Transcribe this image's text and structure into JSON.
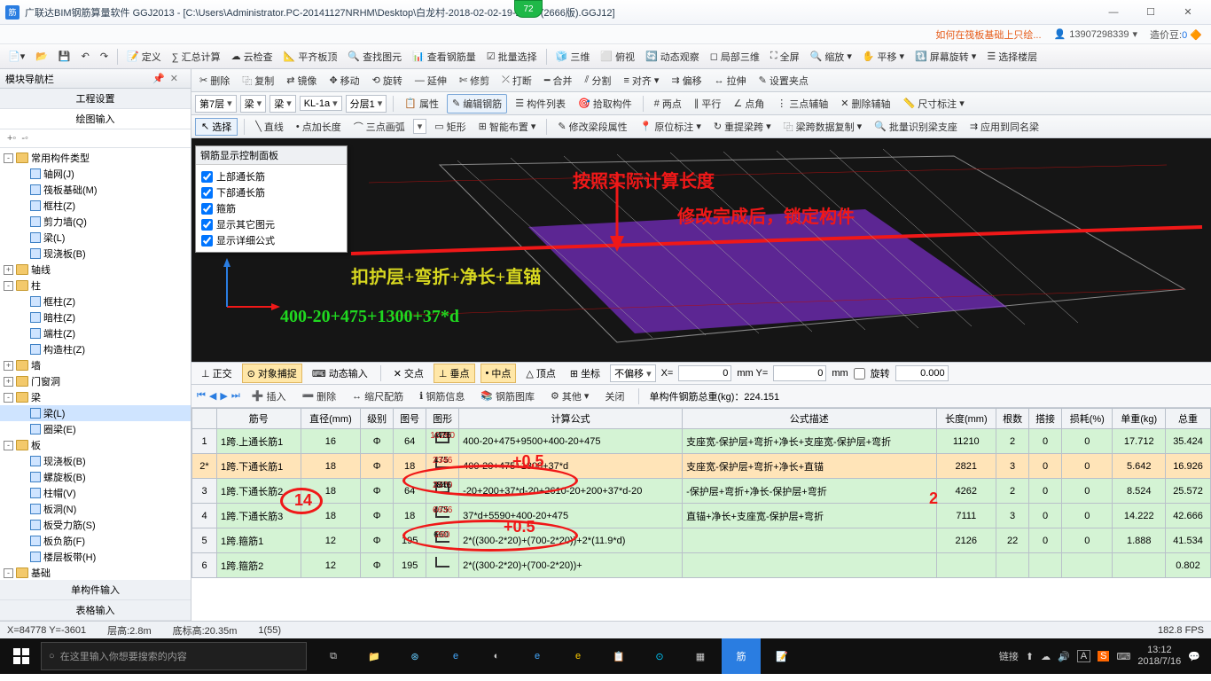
{
  "title": "广联达BIM钢筋算量软件 GGJ2013 - [C:\\Users\\Administrator.PC-20141127NRHM\\Desktop\\白龙村-2018-02-02-19-24-35(2666版).GGJ12]",
  "badge": "72",
  "linkbar": {
    "hot": "如何在筏板基础上只绘...",
    "user": "13907298339",
    "bean_lbl": "造价豆:",
    "bean_val": "0"
  },
  "toolbar1": [
    "定义",
    "∑ 汇总计算",
    "云检查",
    "平齐板顶",
    "查找图元",
    "查看钢筋量",
    "批量选择",
    "",
    "三维",
    "俯视",
    "动态观察",
    "局部三维",
    "全屏",
    "缩放",
    "平移",
    "屏幕旋转",
    "选择楼层"
  ],
  "toolbar2": [
    "删除",
    "复制",
    "镜像",
    "移动",
    "旋转",
    "延伸",
    "修剪",
    "打断",
    "合并",
    "分割",
    "对齐",
    "偏移",
    "拉伸",
    "设置夹点"
  ],
  "toolbar3_left": {
    "floor": "第7层",
    "cat": "梁",
    "type": "梁",
    "name": "KL-1a",
    "layer": "分层1"
  },
  "toolbar3_btns": [
    "属性",
    "编辑钢筋",
    "构件列表",
    "拾取构件",
    "两点",
    "平行",
    "点角",
    "三点辅轴",
    "删除辅轴",
    "尺寸标注"
  ],
  "toolbar4": {
    "select": "选择",
    "line": "直线",
    "pt": "点加长度",
    "arc": "三点画弧",
    "rect": "矩形",
    "auto": "智能布置",
    "mod": "修改梁段属性",
    "orig": "原位标注",
    "redo": "重提梁跨",
    "copy": "梁跨数据复制",
    "batch": "批量识别梁支座",
    "apply": "应用到同名梁"
  },
  "side": {
    "title": "模块导航栏",
    "tabs": [
      "工程设置",
      "绘图输入"
    ],
    "icons": [
      "+◦",
      "-◦"
    ],
    "tree": [
      {
        "t": "常用构件类型",
        "exp": "-",
        "kids": [
          "轴网(J)",
          "筏板基础(M)",
          "框柱(Z)",
          "剪力墙(Q)",
          "梁(L)",
          "现浇板(B)"
        ]
      },
      {
        "t": "轴线",
        "exp": "+"
      },
      {
        "t": "柱",
        "exp": "-",
        "kids": [
          "框柱(Z)",
          "暗柱(Z)",
          "端柱(Z)",
          "构造柱(Z)"
        ]
      },
      {
        "t": "墙",
        "exp": "+"
      },
      {
        "t": "门窗洞",
        "exp": "+"
      },
      {
        "t": "梁",
        "exp": "-",
        "kids": [
          "梁(L)",
          "圈梁(E)"
        ],
        "sel": 0
      },
      {
        "t": "板",
        "exp": "-",
        "kids": [
          "现浇板(B)",
          "螺旋板(B)",
          "柱帽(V)",
          "板洞(N)",
          "板受力筋(S)",
          "板负筋(F)",
          "楼层板带(H)"
        ]
      },
      {
        "t": "基础",
        "exp": "-",
        "kids": [
          "基础梁(F)",
          "筏板基础(M)",
          "集水坑(K)"
        ]
      }
    ],
    "bottom": [
      "单构件输入",
      "表格输入"
    ]
  },
  "panel": {
    "title": "钢筋显示控制面板",
    "items": [
      "上部通长筋",
      "下部通长筋",
      "箍筋",
      "显示其它图元",
      "显示详细公式"
    ]
  },
  "annots": {
    "a1": "按照实际计算长度",
    "a2": "修改完成后，锁定构件",
    "f1": "400-20+475+1300+37*d",
    "f_seg": "扣护层+弯折+净长+直锚"
  },
  "snapbar": {
    "ortho": "正交",
    "obj": "对象捕捉",
    "dyn": "动态输入",
    "pts": [
      "交点",
      "垂点",
      "中点",
      "顶点",
      "坐标"
    ],
    "off": "不偏移",
    "x": "0",
    "y": "0",
    "rot_lbl": "旋转",
    "rot": "0.000"
  },
  "gridtool": {
    "insert": "插入",
    "del": "删除",
    "scale": "缩尺配筋",
    "info": "钢筋信息",
    "lib": "钢筋图库",
    "other": "其他",
    "close": "关闭",
    "weight_lbl": "单构件钢筋总重(kg)：",
    "weight": "224.151"
  },
  "grid": {
    "cols": [
      "",
      "筋号",
      "直径(mm)",
      "级别",
      "图号",
      "图形",
      "计算公式",
      "公式描述",
      "长度(mm)",
      "根数",
      "搭接",
      "损耗(%)",
      "单重(kg)",
      "总重"
    ],
    "rows": [
      {
        "n": "1",
        "id": "1跨.上通长筋1",
        "d": "16",
        "lv": "Φ",
        "fig": "64",
        "sh": {
          "l": "475",
          "m": "10260",
          "r": "475"
        },
        "formula": "400-20+475+9500+400-20+475",
        "desc": "支座宽-保护层+弯折+净长+支座宽-保护层+弯折",
        "len": "11210",
        "cnt": "2",
        "lap": "0",
        "loss": "0",
        "uw": "17.712",
        "tw": "35.424"
      },
      {
        "n": "2*",
        "id": "1跨.下通长筋1",
        "d": "18",
        "lv": "Φ",
        "fig": "18",
        "sh": {
          "l": "475",
          "m": "2346",
          "r": ""
        },
        "formula": "400-20+475+1300+37*d",
        "desc": "支座宽-保护层+弯折+净长+直锚",
        "len": "2821",
        "cnt": "3",
        "lap": "0",
        "loss": "0",
        "uw": "5.642",
        "tw": "16.926",
        "hl": true
      },
      {
        "n": "3",
        "id": "1跨.下通长筋2",
        "d": "18",
        "lv": "Φ",
        "fig": "64",
        "sh": {
          "l": "846",
          "m": "2570",
          "r": "846"
        },
        "formula": "-20+200+37*d-20+2610-20+200+37*d-20",
        "desc": "-保护层+弯折+净长-保护层+弯折",
        "len": "4262",
        "cnt": "2",
        "lap": "0",
        "loss": "0",
        "uw": "8.524",
        "tw": "25.572"
      },
      {
        "n": "4",
        "id": "1跨.下通长筋3",
        "d": "18",
        "lv": "Φ",
        "fig": "18",
        "sh": {
          "l": "475",
          "m": "6636",
          "r": ""
        },
        "formula": "37*d+5590+400-20+475",
        "desc": "直锚+净长+支座宽-保护层+弯折",
        "len": "7111",
        "cnt": "3",
        "lap": "0",
        "loss": "0",
        "uw": "14.222",
        "tw": "42.666"
      },
      {
        "n": "5",
        "id": "1跨.箍筋1",
        "d": "12",
        "lv": "Φ",
        "fig": "195",
        "sh": {
          "l": "660",
          "m": "260",
          "r": ""
        },
        "formula": "2*((300-2*20)+(700-2*20))+2*(11.9*d)",
        "desc": "",
        "len": "2126",
        "cnt": "22",
        "lap": "0",
        "loss": "0",
        "uw": "1.888",
        "tw": "41.534"
      },
      {
        "n": "6",
        "id": "1跨.箍筋2",
        "d": "12",
        "lv": "Φ",
        "fig": "195",
        "sh": {
          "l": "",
          "m": "",
          "r": ""
        },
        "formula": "2*((300-2*20)+(700-2*20))+",
        "desc": "",
        "len": "",
        "cnt": "",
        "lap": "",
        "loss": "",
        "uw": "",
        "tw": "0.802"
      }
    ]
  },
  "overlays": {
    "r14": "14",
    "p05a": "+0.5",
    "p05b": "+0.5",
    "r2": "2"
  },
  "status": {
    "xy": "X=84778 Y=-3601",
    "ch": "层高:2.8m",
    "bh": "底标高:20.35m",
    "sel": "1(55)",
    "fps": "182.8 FPS"
  },
  "taskbar": {
    "search": "在这里输入你想要搜索的内容",
    "link": "链接",
    "time": "13:12",
    "date": "2018/7/16"
  }
}
